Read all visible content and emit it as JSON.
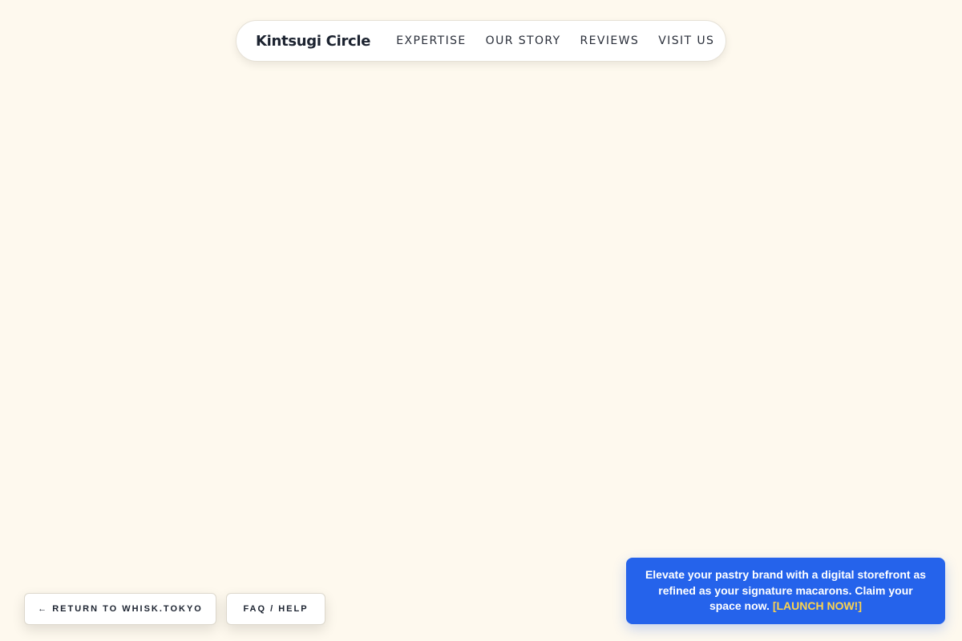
{
  "nav": {
    "brand": "Kintsugi Circle",
    "links": [
      {
        "label": "EXPERTISE"
      },
      {
        "label": "OUR STORY"
      },
      {
        "label": "REVIEWS"
      },
      {
        "label": "VISIT US"
      }
    ]
  },
  "footer_buttons": {
    "return_label": "← RETURN TO WHISK.TOKYO",
    "faq_label": "FAQ / HELP"
  },
  "promo": {
    "message": "Elevate your pastry brand with a digital storefront as refined as your signature macarons. Claim your space now.",
    "cta": "[LAUNCH NOW!]"
  },
  "colors": {
    "background": "#fef9ee",
    "promo_background": "#2563eb",
    "promo_cta": "#fcd34d",
    "text_dark": "#1c2330"
  }
}
